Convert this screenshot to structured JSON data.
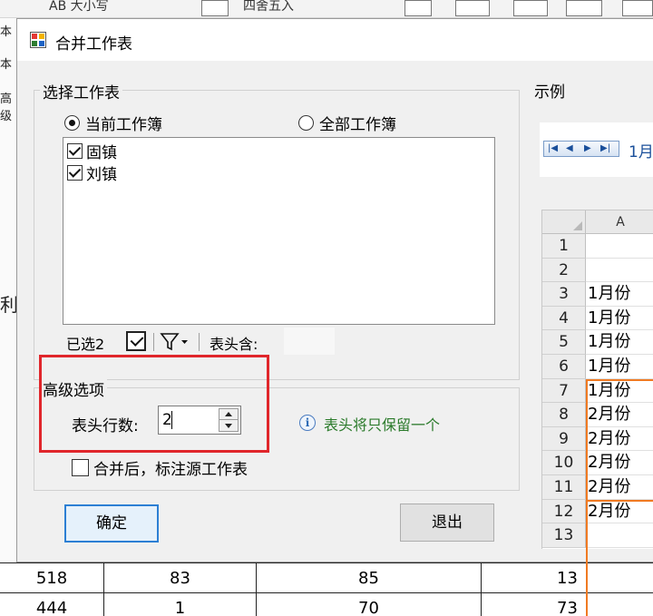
{
  "background": {
    "ribbon": {
      "item1": "AB 大小写",
      "item2": "四舍五入"
    },
    "left_labels": [
      "本",
      "本",
      "高级"
    ],
    "left_partial": "利",
    "rows": [
      [
        "518",
        "83",
        "85",
        "13"
      ],
      [
        "444",
        "1",
        "70",
        "73"
      ]
    ]
  },
  "dialog": {
    "title": "合并工作表",
    "select_group": {
      "label": "选择工作表",
      "radio_current": "当前工作簿",
      "radio_all": "全部工作簿",
      "items": [
        "固镇",
        "刘镇"
      ],
      "selected_count": "已选2",
      "name_contains_label": "表头含:"
    },
    "advanced_group": {
      "label": "高级选项",
      "header_rows_label": "表头行数:",
      "header_rows_value": "2",
      "info_text": "表头将只保留一个",
      "annotate_label": "合并后，标注源工作表"
    },
    "ok_button": "确定",
    "exit_button": "退出",
    "example": {
      "label": "示例",
      "tab_label": "1月",
      "col_header": "A",
      "row_numbers": [
        "1",
        "2",
        "3",
        "4",
        "5",
        "6",
        "7",
        "8",
        "9",
        "10",
        "11",
        "12",
        "13"
      ],
      "cells": [
        "",
        "",
        "1月份",
        "1月份",
        "1月份",
        "1月份",
        "1月份",
        "2月份",
        "2月份",
        "2月份",
        "2月份",
        "2月份",
        ""
      ]
    }
  },
  "colors": {
    "highlight_box": "#e0262b",
    "example_outline": "#f07a22",
    "info_text": "#2a7a2a"
  }
}
